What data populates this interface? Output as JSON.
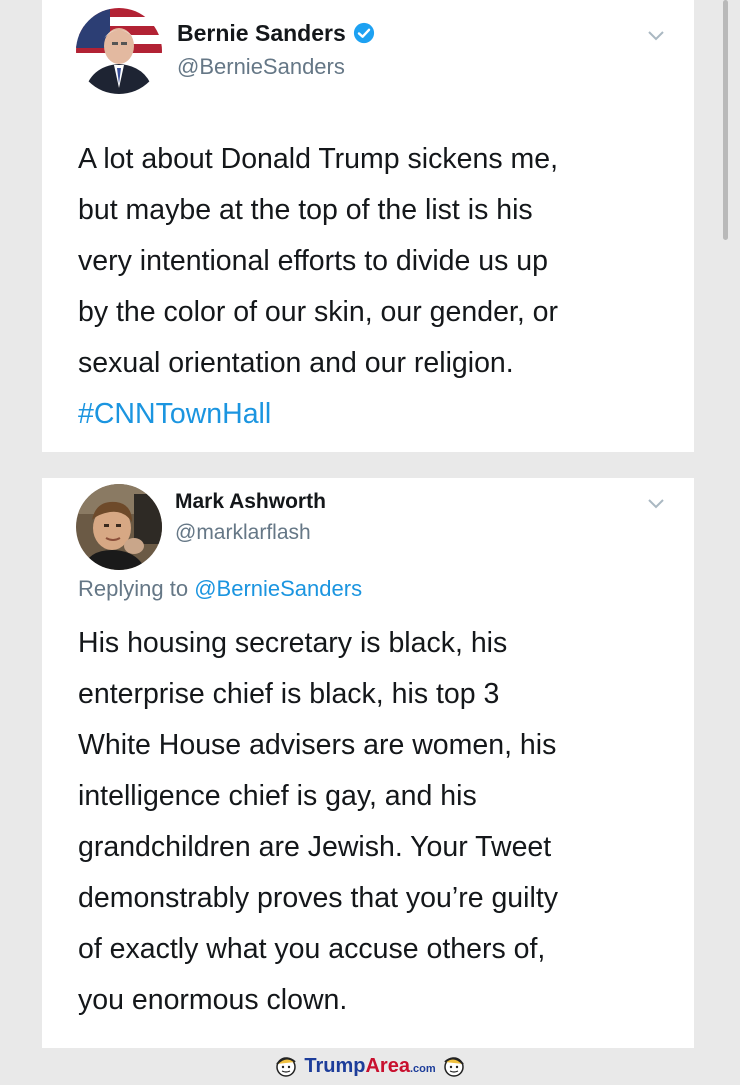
{
  "tweet1": {
    "name": "Bernie Sanders",
    "handle": "@BernieSanders",
    "verified_icon": "verified-badge-icon",
    "menu_icon": "chevron-down-icon",
    "lines": [
      "A lot about Donald Trump sickens me,",
      "but maybe at the top of the list is his",
      "very intentional efforts to divide us up",
      "by the color of our skin, our gender, or",
      "sexual orientation and our religion."
    ],
    "hashtag": "#CNNTownHall"
  },
  "tweet2": {
    "name": "Mark Ashworth",
    "handle": "@marklarflash",
    "menu_icon": "chevron-down-icon",
    "replying_prefix": "Replying to",
    "replying_mention": "@BernieSanders",
    "lines": [
      "His housing secretary is black, his",
      "enterprise chief is black, his top 3",
      "White House advisers are women, his",
      "intelligence chief is gay, and his",
      "grandchildren are Jewish. Your Tweet",
      "demonstrably proves that you’re guilty",
      "of exactly what you accuse others of,",
      "you enormous clown."
    ]
  },
  "footer": {
    "brand_part1": "Trump",
    "brand_part2": "Area",
    "brand_part3": ".com"
  },
  "colors": {
    "link": "#1b95e0",
    "secondary": "#657786",
    "text": "#14171a"
  }
}
